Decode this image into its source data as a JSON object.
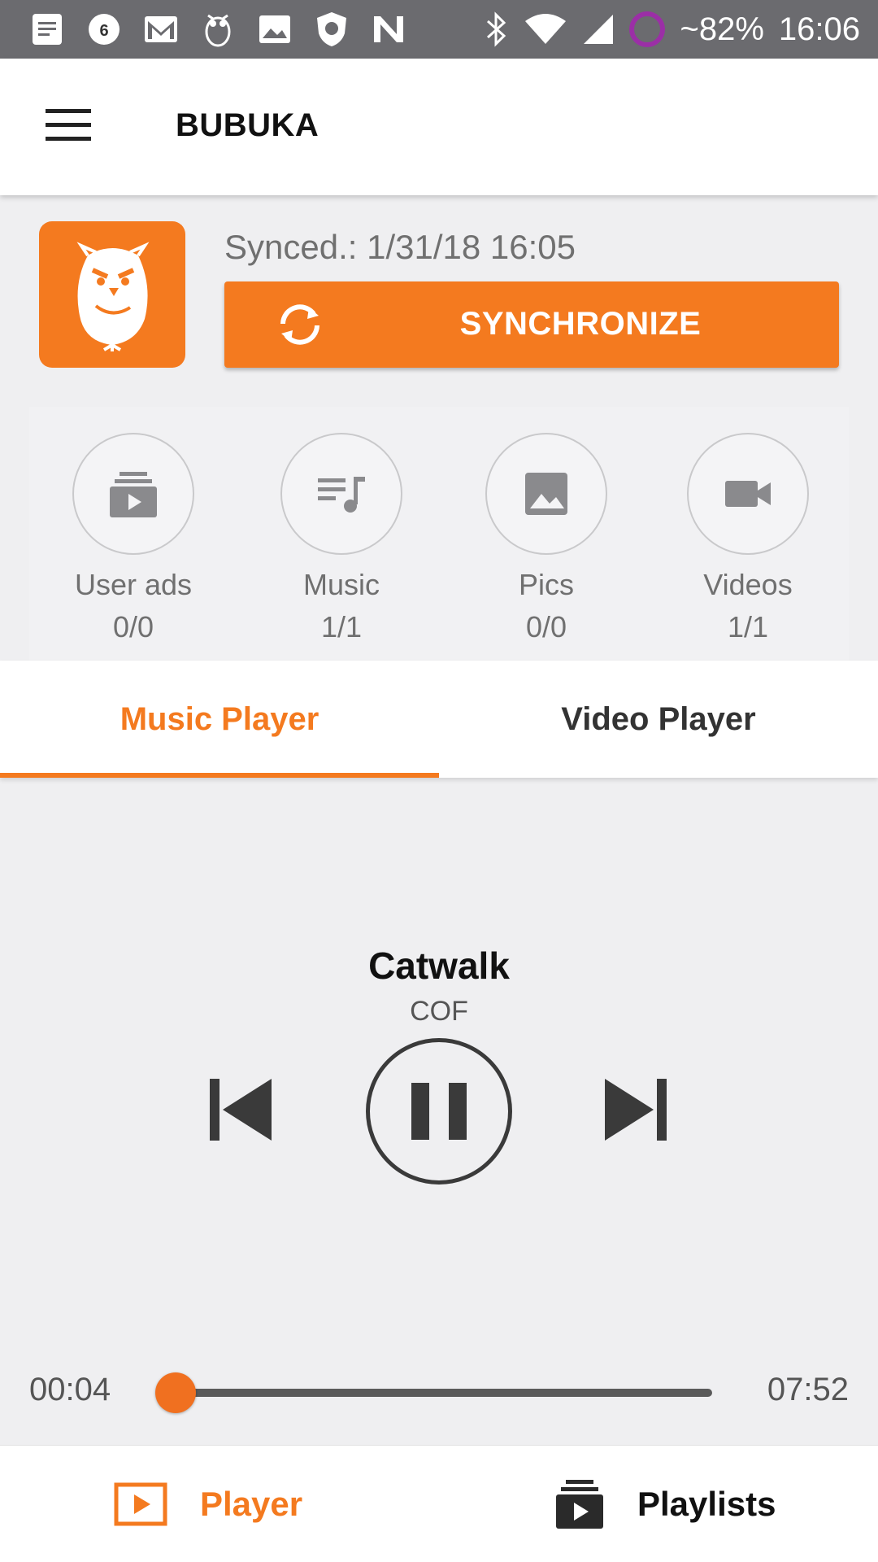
{
  "status_bar": {
    "icons_left": [
      "notes-icon",
      "chat-6-icon",
      "gmail-icon",
      "owl-icon",
      "image-icon",
      "shield-icon",
      "n-icon"
    ],
    "notification_count": "6",
    "battery": "~82%",
    "time": "16:06",
    "battery_ring_color": "#9b2fa6"
  },
  "appbar": {
    "title": "BUBUKA"
  },
  "sync": {
    "synced_text": "Synced.: 1/31/18 16:05",
    "button_label": "SYNCHRONIZE",
    "accent_color": "#f47a1f"
  },
  "stats": [
    {
      "name": "User ads",
      "count": "0/0",
      "icon": "playlist-play-icon"
    },
    {
      "name": "Music",
      "count": "1/1",
      "icon": "music-queue-icon"
    },
    {
      "name": "Pics",
      "count": "0/0",
      "icon": "image-icon"
    },
    {
      "name": "Videos",
      "count": "1/1",
      "icon": "videocam-icon"
    }
  ],
  "tabs": {
    "music": "Music Player",
    "video": "Video Player",
    "active": "Music Player"
  },
  "player": {
    "title": "Catwalk",
    "artist": "COF",
    "current_time": "00:04",
    "total_time": "07:52",
    "progress": 0.0085,
    "state": "playing"
  },
  "bottom_nav": {
    "player": "Player",
    "playlists": "Playlists",
    "active": "Player"
  }
}
